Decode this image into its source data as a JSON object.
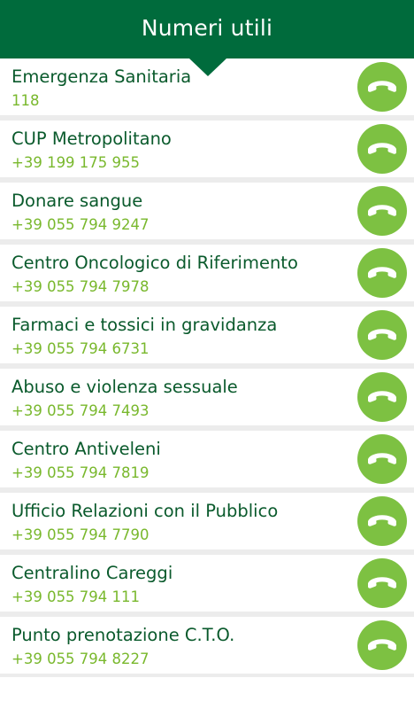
{
  "header": {
    "title": "Numeri utili"
  },
  "colors": {
    "header_bg": "#006b3c",
    "name_text": "#0a5a2c",
    "phone_text": "#79b82d",
    "call_button": "#7dc142"
  },
  "contacts": [
    {
      "name": "Emergenza Sanitaria",
      "phone": "118"
    },
    {
      "name": "CUP Metropolitano",
      "phone": "+39 199 175 955"
    },
    {
      "name": "Donare sangue",
      "phone": "+39 055 794 9247"
    },
    {
      "name": "Centro Oncologico di Riferimento",
      "phone": "+39 055 794 7978"
    },
    {
      "name": "Farmaci e tossici in gravidanza",
      "phone": "+39 055 794 6731"
    },
    {
      "name": "Abuso e violenza sessuale",
      "phone": "+39 055 794 7493"
    },
    {
      "name": "Centro Antiveleni",
      "phone": "+39 055 794 7819"
    },
    {
      "name": "Ufficio Relazioni con il Pubblico",
      "phone": "+39 055 794 7790"
    },
    {
      "name": "Centralino Careggi",
      "phone": "+39 055 794 111"
    },
    {
      "name": "Punto prenotazione C.T.O.",
      "phone": "+39 055 794 8227"
    }
  ],
  "icons": {
    "call": "phone-handset-icon"
  }
}
